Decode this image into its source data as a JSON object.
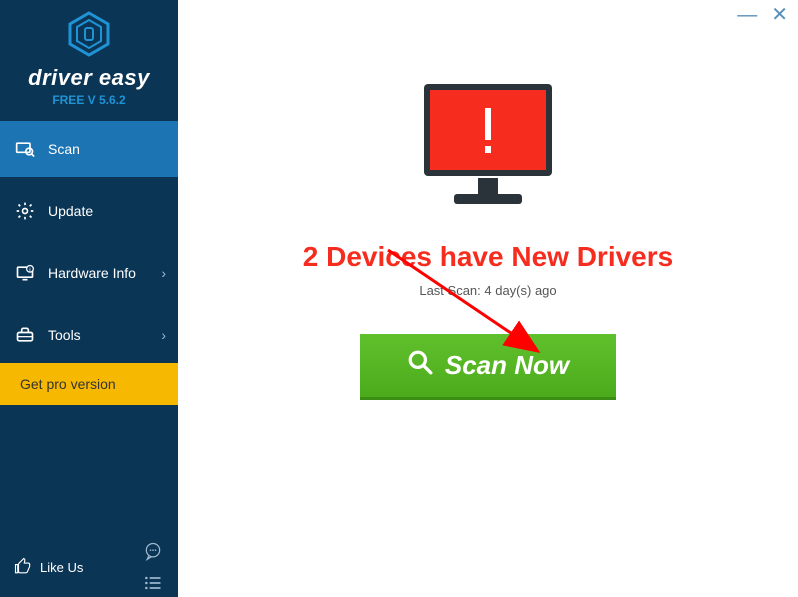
{
  "brand": {
    "name": "driver easy",
    "version": "FREE V 5.6.2"
  },
  "sidebar": {
    "items": [
      {
        "label": "Scan"
      },
      {
        "label": "Update"
      },
      {
        "label": "Hardware Info"
      },
      {
        "label": "Tools"
      }
    ],
    "upgrade_label": "Get pro version",
    "likeus_label": "Like Us"
  },
  "main": {
    "headline": "2 Devices have New Drivers",
    "last_scan": "Last Scan: 4 day(s) ago",
    "scan_button": "Scan Now"
  }
}
